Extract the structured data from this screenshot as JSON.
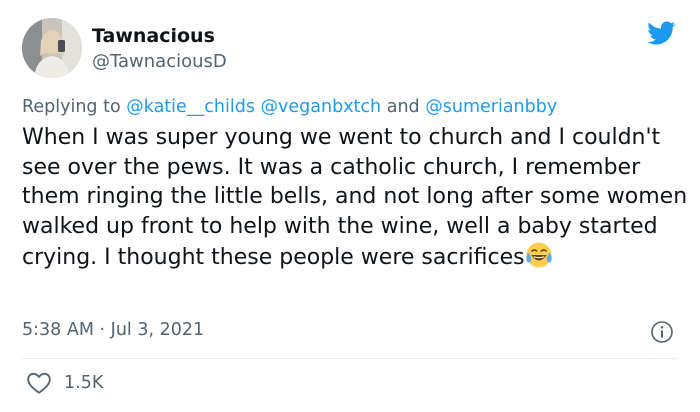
{
  "user": {
    "display_name": "Tawnacious",
    "handle": "@TawnaciousD",
    "avatar_icon": "profile-photo"
  },
  "reply": {
    "prefix": "Replying to",
    "mention_1": "@katie__childs",
    "mention_2": "@veganbxtch",
    "conjunction": "and",
    "mention_3": "@sumerianbby"
  },
  "tweet": {
    "text": "When I was super young we went to church and I couldn't see over the pews. It was a catholic church, I remember them ringing the little bells, and not long after some women walked up front to help with the wine, well a baby started crying. I thought these people were sacrifices",
    "emoji": "face-with-tears-of-joy"
  },
  "meta": {
    "time": "5:38 AM",
    "separator": "·",
    "date": "Jul 3, 2021"
  },
  "stats": {
    "likes": "1.5K"
  },
  "icons": {
    "brand": "twitter-bird",
    "info": "info-circle",
    "like": "heart-outline"
  },
  "colors": {
    "brand": "#1d9bf0",
    "muted": "#536471",
    "text": "#0f1419",
    "divider": "#e6ecf0"
  }
}
